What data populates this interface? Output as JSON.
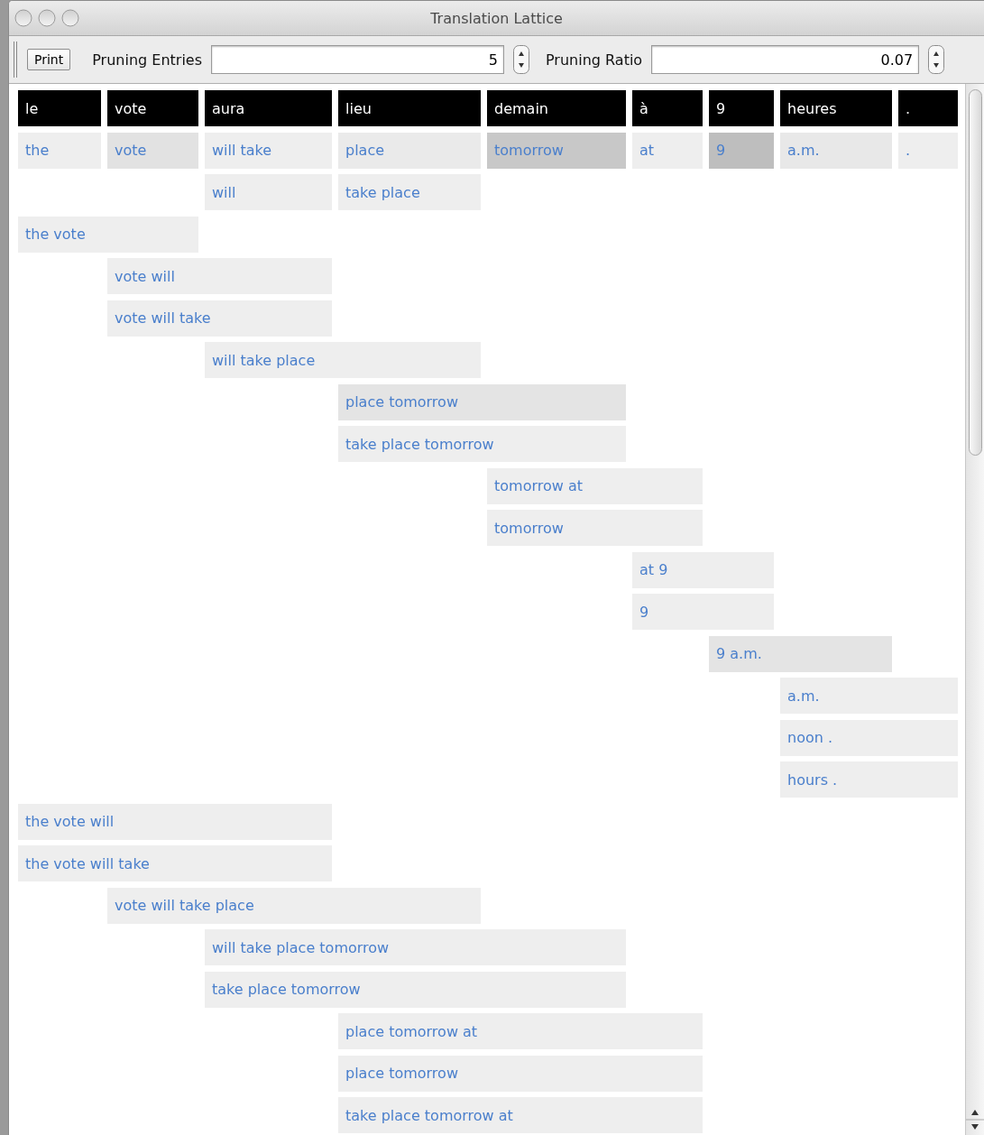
{
  "window": {
    "title": "Translation Lattice"
  },
  "toolbar": {
    "print_button": "Print",
    "pruning_entries": {
      "label": "Pruning Entries",
      "value": "5"
    },
    "pruning_ratio": {
      "label": "Pruning Ratio",
      "value": "0.07"
    }
  },
  "source_words": [
    "le",
    "vote",
    "aura",
    "lieu",
    "demain",
    "à",
    "9",
    "heures",
    "."
  ],
  "lattice": [
    {
      "slots": [
        {
          "kind": "entry",
          "text": "the",
          "color": "#eeeeee"
        },
        {
          "kind": "entry",
          "text": "vote",
          "color": "#e2e2e2"
        },
        {
          "kind": "entry",
          "text": "will take",
          "color": "#eeeeee"
        },
        {
          "kind": "entry",
          "text": "place",
          "color": "#eaeaea"
        },
        {
          "kind": "entry",
          "text": "tomorrow",
          "color": "#c8c8c8"
        },
        {
          "kind": "entry",
          "text": "at",
          "color": "#eeeeee"
        },
        {
          "kind": "entry",
          "text": "9",
          "color": "#bebebe"
        },
        {
          "kind": "entry",
          "text": "a.m.",
          "color": "#e8e8e8"
        },
        {
          "kind": "entry",
          "text": ".",
          "color": "#eeeeee"
        }
      ]
    },
    {
      "slots": [
        {
          "kind": "gap"
        },
        {
          "kind": "gap"
        },
        {
          "kind": "entry",
          "text": "will",
          "color": "#eeeeee"
        },
        {
          "kind": "entry",
          "text": "take place",
          "color": "#eeeeee"
        }
      ]
    },
    {
      "slots": [
        {
          "kind": "entry",
          "text": "the vote",
          "color": "#eeeeee"
        },
        {
          "kind": "continued"
        }
      ]
    },
    {
      "slots": [
        {
          "kind": "gap"
        },
        {
          "kind": "entry",
          "text": "vote will",
          "color": "#eeeeee"
        },
        {
          "kind": "continued"
        }
      ]
    },
    {
      "slots": [
        {
          "kind": "gap"
        },
        {
          "kind": "entry",
          "text": "vote will take",
          "color": "#eeeeee"
        },
        {
          "kind": "continued"
        }
      ]
    },
    {
      "slots": [
        {
          "kind": "gap"
        },
        {
          "kind": "gap"
        },
        {
          "kind": "entry",
          "text": "will take place",
          "color": "#eeeeee"
        },
        {
          "kind": "continued"
        }
      ]
    },
    {
      "slots": [
        {
          "kind": "gap"
        },
        {
          "kind": "gap"
        },
        {
          "kind": "gap"
        },
        {
          "kind": "entry",
          "text": "place tomorrow",
          "color": "#e4e4e4"
        },
        {
          "kind": "continued"
        }
      ]
    },
    {
      "slots": [
        {
          "kind": "gap"
        },
        {
          "kind": "gap"
        },
        {
          "kind": "gap"
        },
        {
          "kind": "entry",
          "text": "take place tomorrow",
          "color": "#eeeeee"
        },
        {
          "kind": "continued"
        }
      ]
    },
    {
      "slots": [
        {
          "kind": "gap"
        },
        {
          "kind": "gap"
        },
        {
          "kind": "gap"
        },
        {
          "kind": "gap"
        },
        {
          "kind": "entry",
          "text": "tomorrow at",
          "color": "#eeeeee"
        },
        {
          "kind": "continued"
        }
      ]
    },
    {
      "slots": [
        {
          "kind": "gap"
        },
        {
          "kind": "gap"
        },
        {
          "kind": "gap"
        },
        {
          "kind": "gap"
        },
        {
          "kind": "entry",
          "text": "tomorrow",
          "color": "#eeeeee"
        },
        {
          "kind": "continued"
        }
      ]
    },
    {
      "slots": [
        {
          "kind": "gap"
        },
        {
          "kind": "gap"
        },
        {
          "kind": "gap"
        },
        {
          "kind": "gap"
        },
        {
          "kind": "gap"
        },
        {
          "kind": "entry",
          "text": "at 9",
          "color": "#eeeeee"
        },
        {
          "kind": "continued"
        }
      ]
    },
    {
      "slots": [
        {
          "kind": "gap"
        },
        {
          "kind": "gap"
        },
        {
          "kind": "gap"
        },
        {
          "kind": "gap"
        },
        {
          "kind": "gap"
        },
        {
          "kind": "entry",
          "text": "9",
          "color": "#eeeeee"
        },
        {
          "kind": "continued"
        }
      ]
    },
    {
      "slots": [
        {
          "kind": "gap"
        },
        {
          "kind": "gap"
        },
        {
          "kind": "gap"
        },
        {
          "kind": "gap"
        },
        {
          "kind": "gap"
        },
        {
          "kind": "gap"
        },
        {
          "kind": "entry",
          "text": "9 a.m.",
          "color": "#e4e4e4"
        },
        {
          "kind": "continued"
        }
      ]
    },
    {
      "slots": [
        {
          "kind": "gap"
        },
        {
          "kind": "gap"
        },
        {
          "kind": "gap"
        },
        {
          "kind": "gap"
        },
        {
          "kind": "gap"
        },
        {
          "kind": "gap"
        },
        {
          "kind": "gap"
        },
        {
          "kind": "entry",
          "text": "a.m.",
          "color": "#eeeeee"
        },
        {
          "kind": "continued"
        }
      ]
    },
    {
      "slots": [
        {
          "kind": "gap"
        },
        {
          "kind": "gap"
        },
        {
          "kind": "gap"
        },
        {
          "kind": "gap"
        },
        {
          "kind": "gap"
        },
        {
          "kind": "gap"
        },
        {
          "kind": "gap"
        },
        {
          "kind": "entry",
          "text": "noon .",
          "color": "#eeeeee"
        },
        {
          "kind": "continued"
        }
      ]
    },
    {
      "slots": [
        {
          "kind": "gap"
        },
        {
          "kind": "gap"
        },
        {
          "kind": "gap"
        },
        {
          "kind": "gap"
        },
        {
          "kind": "gap"
        },
        {
          "kind": "gap"
        },
        {
          "kind": "gap"
        },
        {
          "kind": "entry",
          "text": "hours .",
          "color": "#eeeeee"
        },
        {
          "kind": "continued"
        }
      ]
    },
    {
      "slots": [
        {
          "kind": "entry",
          "text": "the vote will",
          "color": "#eeeeee"
        },
        {
          "kind": "continued"
        },
        {
          "kind": "continued"
        }
      ]
    },
    {
      "slots": [
        {
          "kind": "entry",
          "text": "the vote will take",
          "color": "#eeeeee"
        },
        {
          "kind": "continued"
        },
        {
          "kind": "continued"
        }
      ]
    },
    {
      "slots": [
        {
          "kind": "gap"
        },
        {
          "kind": "entry",
          "text": "vote will take place",
          "color": "#eeeeee"
        },
        {
          "kind": "continued"
        },
        {
          "kind": "continued"
        }
      ]
    },
    {
      "slots": [
        {
          "kind": "gap"
        },
        {
          "kind": "gap"
        },
        {
          "kind": "entry",
          "text": "will take place tomorrow",
          "color": "#eeeeee"
        },
        {
          "kind": "continued"
        },
        {
          "kind": "continued"
        }
      ]
    },
    {
      "slots": [
        {
          "kind": "gap"
        },
        {
          "kind": "gap"
        },
        {
          "kind": "entry",
          "text": "take place tomorrow",
          "color": "#eeeeee"
        },
        {
          "kind": "continued"
        },
        {
          "kind": "continued"
        }
      ]
    },
    {
      "slots": [
        {
          "kind": "gap"
        },
        {
          "kind": "gap"
        },
        {
          "kind": "gap"
        },
        {
          "kind": "entry",
          "text": "place tomorrow at",
          "color": "#eeeeee"
        },
        {
          "kind": "continued"
        },
        {
          "kind": "continued"
        }
      ]
    },
    {
      "slots": [
        {
          "kind": "gap"
        },
        {
          "kind": "gap"
        },
        {
          "kind": "gap"
        },
        {
          "kind": "entry",
          "text": "place tomorrow",
          "color": "#eeeeee"
        },
        {
          "kind": "continued"
        },
        {
          "kind": "continued"
        }
      ]
    },
    {
      "slots": [
        {
          "kind": "gap"
        },
        {
          "kind": "gap"
        },
        {
          "kind": "gap"
        },
        {
          "kind": "entry",
          "text": "take place tomorrow at",
          "color": "#eeeeee"
        },
        {
          "kind": "continued"
        },
        {
          "kind": "continued"
        }
      ]
    }
  ]
}
